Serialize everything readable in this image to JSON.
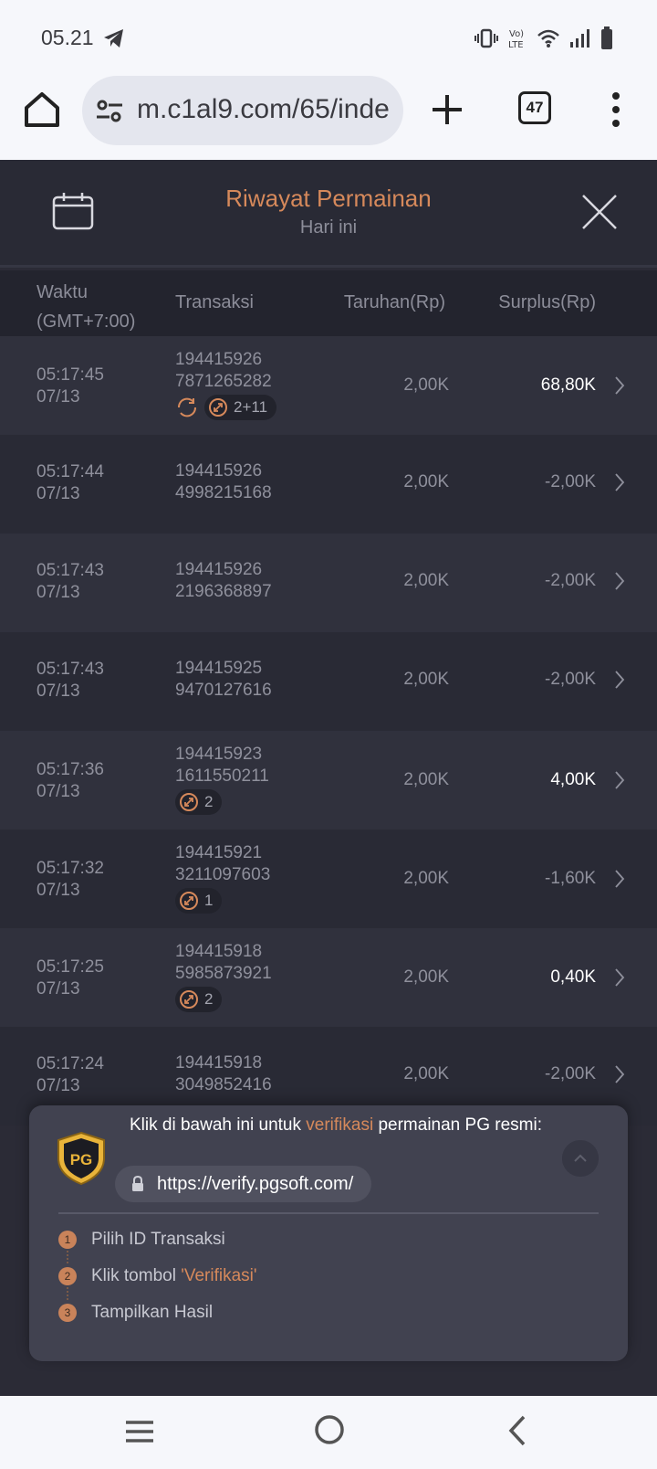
{
  "status_bar": {
    "time": "05.21",
    "telegram_icon": "telegram-icon",
    "icons": [
      "vibrate-icon",
      "volte-icon",
      "wifi-icon",
      "signal-icon",
      "battery-icon"
    ]
  },
  "browser": {
    "url": "m.c1al9.com/65/inde",
    "tab_count": "47",
    "icons": [
      "home-icon",
      "site-settings-icon",
      "plus-icon",
      "tabs-icon",
      "more-vert-icon"
    ]
  },
  "header": {
    "title": "Riwayat Permainan",
    "subtitle": "Hari ini",
    "icons": [
      "calendar-icon",
      "close-icon"
    ]
  },
  "columns": {
    "time": "Waktu",
    "time_tz": "(GMT+7:00)",
    "transaction": "Transaksi",
    "bet": "Taruhan(Rp)",
    "surplus": "Surplus(Rp)"
  },
  "rows": [
    {
      "time": "05:17:45",
      "date": "07/13",
      "tx1": "194415926",
      "tx2": "7871265282",
      "bet": "2,00K",
      "surplus": "68,80K",
      "positive": true,
      "spin_icon": true,
      "badge": "2+11"
    },
    {
      "time": "05:17:44",
      "date": "07/13",
      "tx1": "194415926",
      "tx2": "4998215168",
      "bet": "2,00K",
      "surplus": "-2,00K",
      "positive": false,
      "spin_icon": false,
      "badge": ""
    },
    {
      "time": "05:17:43",
      "date": "07/13",
      "tx1": "194415926",
      "tx2": "2196368897",
      "bet": "2,00K",
      "surplus": "-2,00K",
      "positive": false,
      "spin_icon": false,
      "badge": ""
    },
    {
      "time": "05:17:43",
      "date": "07/13",
      "tx1": "194415925",
      "tx2": "9470127616",
      "bet": "2,00K",
      "surplus": "-2,00K",
      "positive": false,
      "spin_icon": false,
      "badge": ""
    },
    {
      "time": "05:17:36",
      "date": "07/13",
      "tx1": "194415923",
      "tx2": "1611550211",
      "bet": "2,00K",
      "surplus": "4,00K",
      "positive": true,
      "spin_icon": false,
      "badge": "2"
    },
    {
      "time": "05:17:32",
      "date": "07/13",
      "tx1": "194415921",
      "tx2": "3211097603",
      "bet": "2,00K",
      "surplus": "-1,60K",
      "positive": false,
      "spin_icon": false,
      "badge": "1"
    },
    {
      "time": "05:17:25",
      "date": "07/13",
      "tx1": "194415918",
      "tx2": "5985873921",
      "bet": "2,00K",
      "surplus": "0,40K",
      "positive": true,
      "spin_icon": false,
      "badge": "2"
    },
    {
      "time": "05:17:24",
      "date": "07/13",
      "tx1": "194415918",
      "tx2": "3049852416",
      "bet": "2,00K",
      "surplus": "-2,00K",
      "positive": false,
      "spin_icon": false,
      "badge": ""
    }
  ],
  "verify": {
    "logo_text": "PG",
    "msg_before": "Klik di bawah ini untuk ",
    "msg_highlight": "verifikasi",
    "msg_after": " permainan PG resmi:",
    "url": "https://verify.pgsoft.com/",
    "steps": [
      {
        "num": "1",
        "before": "Pilih ID Transaksi",
        "highlight": ""
      },
      {
        "num": "2",
        "before": "Klik tombol ",
        "highlight": "'Verifikasi'"
      },
      {
        "num": "3",
        "before": "Tampilkan Hasil",
        "highlight": ""
      }
    ]
  },
  "nav": {
    "icons": [
      "recents-icon",
      "home-circle-icon",
      "back-icon"
    ]
  },
  "colors": {
    "accent": "#d6895b",
    "background": "#2b2b36",
    "row_alt": "#30313d",
    "panel": "#414250"
  }
}
